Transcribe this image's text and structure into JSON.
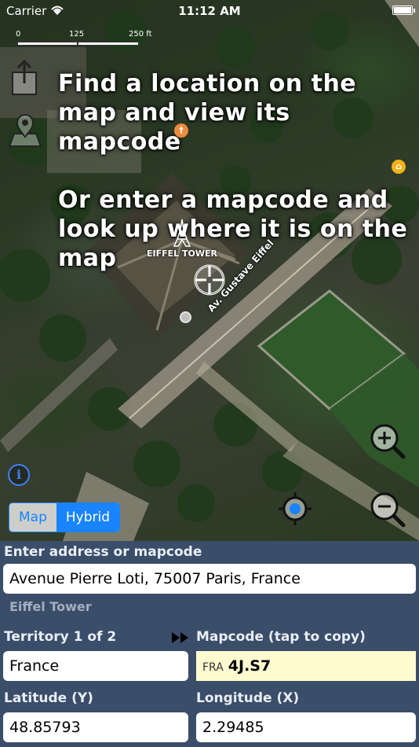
{
  "status_bar": {
    "carrier": "Carrier",
    "time": "11:12 AM",
    "wifi_icon": "wifi-icon",
    "battery_icon": "battery-icon"
  },
  "map": {
    "scale_bar": {
      "ticks": [
        "0",
        "125",
        "250 ft"
      ]
    },
    "instructions": {
      "line1": "Find a location on the map and view its mapcode",
      "line2": "Or enter a mapcode and look up where it is on the map"
    },
    "landmark_label": "EIFFEL TOWER",
    "street_label": "Av. Gustave Eiffel",
    "map_type": {
      "options": [
        "Map",
        "Hybrid"
      ],
      "selected": "Hybrid"
    },
    "icons": {
      "share": "share-icon",
      "map_pin": "map-pin-icon",
      "info": "info-icon",
      "zoom_in": "zoom-in-icon",
      "zoom_out": "zoom-out-icon",
      "locate": "locate-icon",
      "crosshair": "crosshair-icon",
      "restaurant": "restaurant-icon",
      "shop": "shop-icon"
    },
    "info_glyph": "i"
  },
  "panel": {
    "search_label": "Enter address or mapcode",
    "search_value": "Avenue Pierre Loti, 75007 Paris, France",
    "search_result": "Eiffel Tower",
    "territory_label": "Territory 1 of 2",
    "mapcode_label": "Mapcode (tap to copy)",
    "territory_value": "France",
    "mapcode_prefix": "FRA",
    "mapcode_value": "4J.S7",
    "latitude_label": "Latitude (Y)",
    "longitude_label": "Longitude (X)",
    "latitude_value": "48.85793",
    "longitude_value": "2.29485"
  },
  "colors": {
    "panel_background": "#3a4d69",
    "accent_blue": "#1a84ff",
    "mapcode_background": "#fffbd0",
    "restaurant_poi": "#f08a3c",
    "shop_poi": "#f2b21c"
  }
}
